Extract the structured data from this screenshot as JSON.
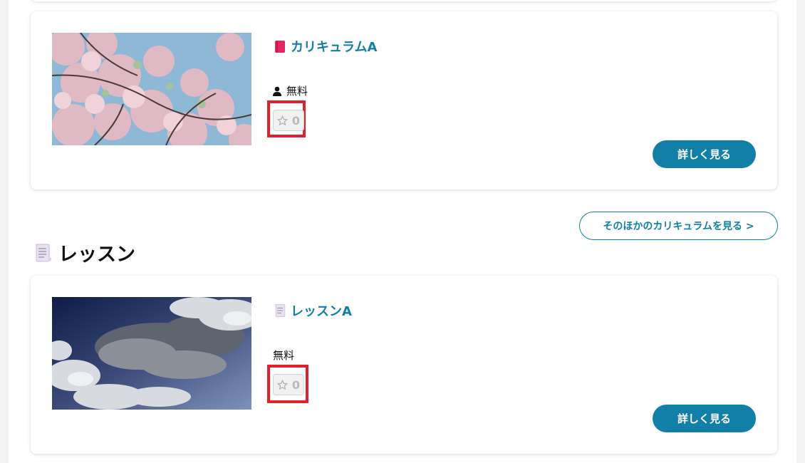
{
  "curriculum_card": {
    "title": "カリキュラムA",
    "price": "無料",
    "favorite_count": "0",
    "detail_button": "詳しく見る",
    "icon": "book-icon"
  },
  "more_curriculum_button": "そのほかのカリキュラムを見る >",
  "lesson_section": {
    "heading": "レッスン",
    "icon": "scroll-icon"
  },
  "lesson_card": {
    "title": "レッスンA",
    "price": "無料",
    "favorite_count": "0",
    "detail_button": "詳しく見る",
    "icon": "scroll-icon"
  },
  "colors": {
    "accent": "#127fa6",
    "highlight": "#e0202a"
  }
}
